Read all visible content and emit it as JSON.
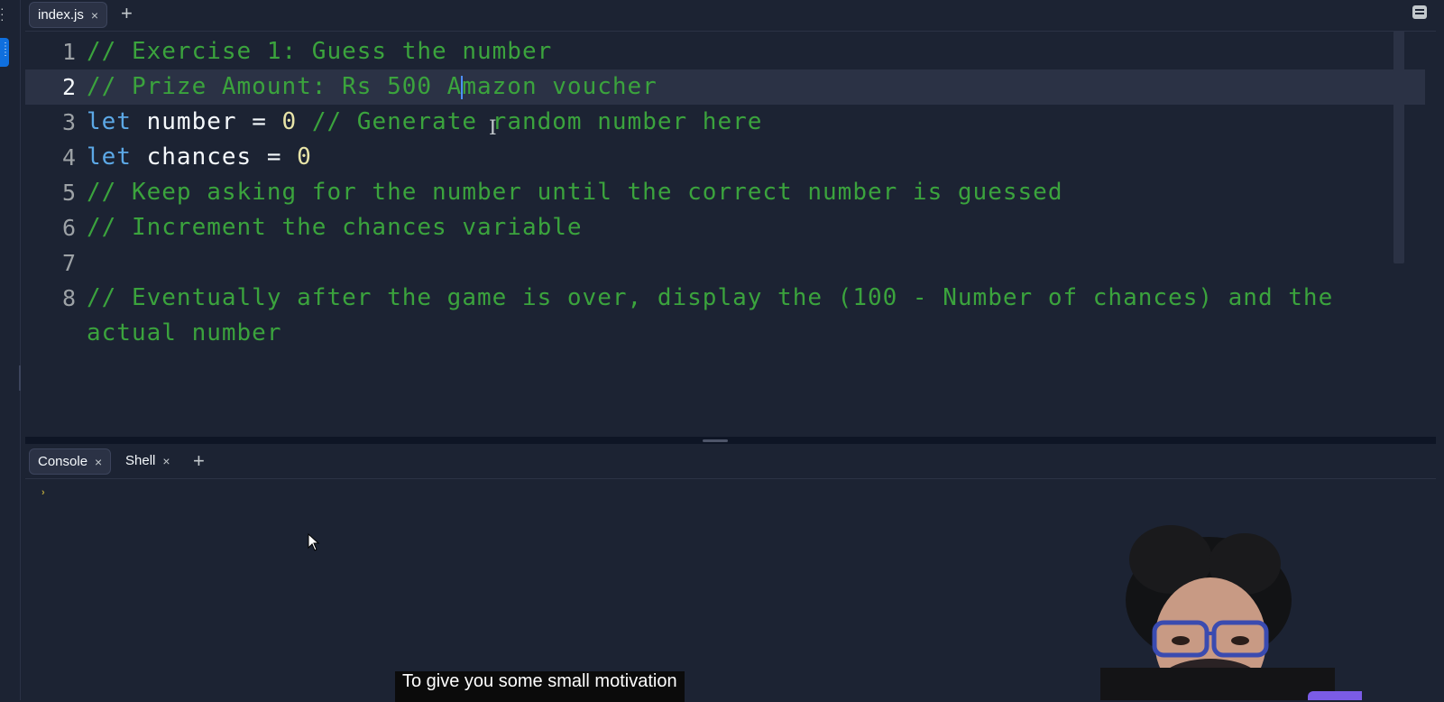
{
  "editor": {
    "tabs": [
      {
        "label": "index.js",
        "close": "×",
        "active": true
      }
    ],
    "add_tab": "+",
    "lines": [
      {
        "num": "1",
        "tokens": [
          {
            "t": "// Exercise 1: Guess the number",
            "k": "comment"
          }
        ]
      },
      {
        "num": "2",
        "current": true,
        "before_caret": "// Prize Amount: Rs 500 A",
        "after_caret": "mazon voucher"
      },
      {
        "num": "3",
        "tokens": [
          {
            "t": "let",
            "k": "kw"
          },
          {
            "t": " number ",
            "k": "id"
          },
          {
            "t": "= ",
            "k": "op"
          },
          {
            "t": "0",
            "k": "num"
          },
          {
            "t": " // Generate random number here",
            "k": "comment"
          }
        ]
      },
      {
        "num": "4",
        "tokens": [
          {
            "t": "let",
            "k": "kw"
          },
          {
            "t": " chances ",
            "k": "id"
          },
          {
            "t": "= ",
            "k": "op"
          },
          {
            "t": "0",
            "k": "num"
          }
        ]
      },
      {
        "num": "5",
        "tokens": [
          {
            "t": "// Keep asking for the number until the correct number is guessed",
            "k": "comment"
          }
        ]
      },
      {
        "num": "6",
        "tokens": [
          {
            "t": "// Increment the chances variable",
            "k": "comment"
          }
        ]
      },
      {
        "num": "7",
        "tokens": []
      },
      {
        "num": "8",
        "wrap": true,
        "tokens": [
          {
            "t": "// Eventually after the game is over, display the (100 - Number of chances) and the actual number",
            "k": "comment"
          }
        ]
      }
    ]
  },
  "console": {
    "tabs": [
      {
        "label": "Console",
        "close": "×",
        "active": true
      },
      {
        "label": "Shell",
        "close": "×",
        "active": false
      }
    ],
    "add_tab": "+",
    "prompt": "›"
  },
  "subtitle": "To give you some small motivation"
}
